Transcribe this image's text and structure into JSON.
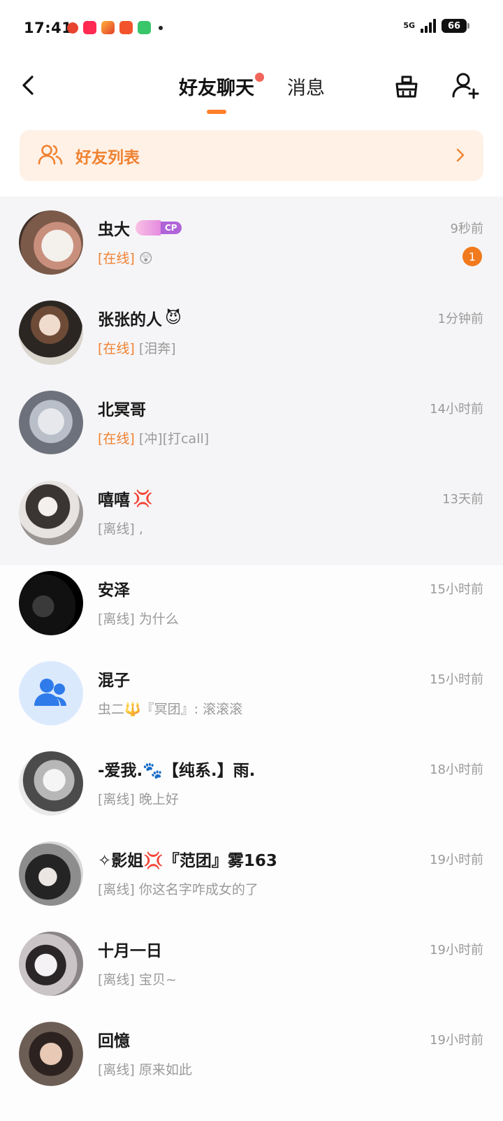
{
  "status_bar": {
    "time": "17:41",
    "network": "5G",
    "battery": "66"
  },
  "header": {
    "tabs": [
      {
        "label": "好友聊天",
        "active": true,
        "has_dot": true
      },
      {
        "label": "消息",
        "active": false,
        "has_dot": false
      }
    ],
    "icons": [
      "back-icon",
      "clean-icon",
      "add-friend-icon"
    ]
  },
  "friend_list_banner": {
    "label": "好友列表",
    "icon": "friends-icon"
  },
  "chats": [
    {
      "name": "虫大",
      "badge": "CP",
      "time": "9秒前",
      "status": "[在线]",
      "preview": "😲",
      "unread": "1",
      "online": true
    },
    {
      "name": "张张的人",
      "emoji": "😈",
      "time": "1分钟前",
      "status": "[在线]",
      "preview": "[泪奔]",
      "online": true
    },
    {
      "name": "北冥哥",
      "time": "14小时前",
      "status": "[在线]",
      "preview": "[冲][打call]",
      "online": true
    },
    {
      "name": "嘻嘻",
      "emoji": "💢",
      "time": "13天前",
      "status": "[离线]",
      "preview": ",",
      "online": false
    },
    {
      "name": "安泽",
      "time": "15小时前",
      "status": "[离线]",
      "preview": "为什么",
      "online": false
    },
    {
      "name": "混子",
      "time": "15小时前",
      "status": "",
      "preview": "虫二🔱『冥团』: 滚滚滚",
      "online": false,
      "group": true
    },
    {
      "name": "-爱我.🐾【纯系.】雨.",
      "time": "18小时前",
      "status": "[离线]",
      "preview": "晚上好",
      "online": false
    },
    {
      "name": "✧影姐💢『范团』雾163",
      "time": "19小时前",
      "status": "[离线]",
      "preview": "你这名字咋成女的了",
      "online": false
    },
    {
      "name": "十月一日",
      "time": "19小时前",
      "status": "[离线]",
      "preview": "宝贝~",
      "online": false
    },
    {
      "name": "回憶",
      "time": "19小时前",
      "status": "[离线]",
      "preview": "原来如此",
      "online": false
    }
  ],
  "colors": {
    "accent": "#f08231",
    "banner_bg": "#fff1e6",
    "unread": "#f07a1d",
    "tab_dot": "#f2655a",
    "muted_text": "#9a9a9a",
    "pinned_bg": "#f5f5f7"
  }
}
